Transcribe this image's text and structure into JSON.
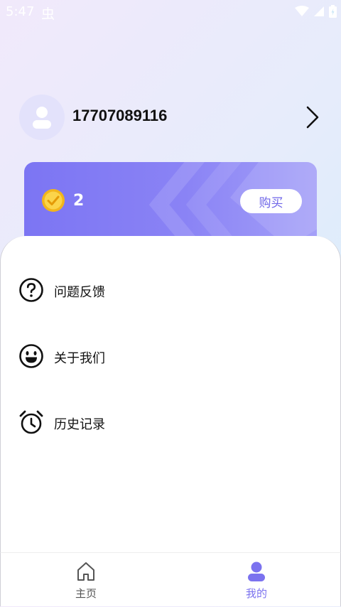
{
  "status_bar": {
    "time": "5:47",
    "app_icon_glyph": "虫"
  },
  "profile": {
    "username": "17707089116"
  },
  "coins": {
    "count": "2",
    "buy_label": "购买"
  },
  "menu": [
    {
      "label": "问题反馈",
      "icon": "question-circle-icon"
    },
    {
      "label": "关于我们",
      "icon": "smiley-icon"
    },
    {
      "label": "历史记录",
      "icon": "alarm-clock-icon"
    }
  ],
  "bottom_nav": {
    "tabs": [
      {
        "label": "主页",
        "icon": "home-icon",
        "active": false
      },
      {
        "label": "我的",
        "icon": "user-icon",
        "active": true
      }
    ]
  },
  "colors": {
    "accent": "#7b72ef",
    "card_start": "#7c75f3",
    "card_end": "#a4a0f8",
    "avatar_bg": "#e3e2fb",
    "inactive_nav": "#555555"
  }
}
